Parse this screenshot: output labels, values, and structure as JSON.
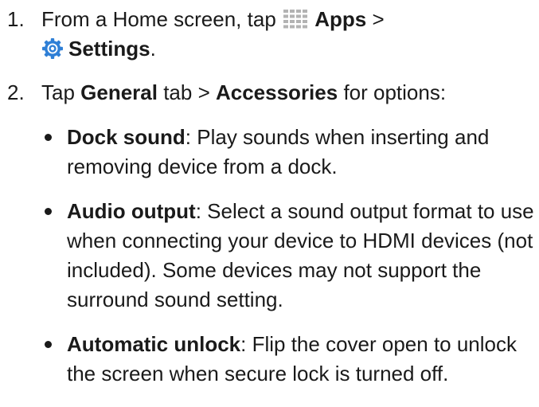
{
  "steps": [
    {
      "number": "1.",
      "prefix": "From a Home screen, tap ",
      "apps_icon": "apps-grid-icon",
      "apps_label": "Apps",
      "separator": " >",
      "settings_icon": "settings-gear-icon",
      "settings_label": "Settings",
      "end": "."
    },
    {
      "number": "2.",
      "tap": "Tap ",
      "general_label": "General",
      "mid": " tab > ",
      "accessories_label": "Accessories",
      "suffix": " for options:"
    }
  ],
  "options": [
    {
      "title": "Dock sound",
      "desc": ": Play sounds when inserting and removing device from a dock."
    },
    {
      "title": "Audio output",
      "desc": ": Select a sound output format to use when connecting your device to HDMI devices (not included). Some devices may not support the surround sound setting."
    },
    {
      "title": "Automatic unlock",
      "desc": ": Flip the cover open to unlock the screen when secure lock is turned off."
    }
  ],
  "colors": {
    "text": "#1a1a1a",
    "apps_icon_grey": "#b3b3b3",
    "settings_icon_blue": "#2e7fd6"
  }
}
